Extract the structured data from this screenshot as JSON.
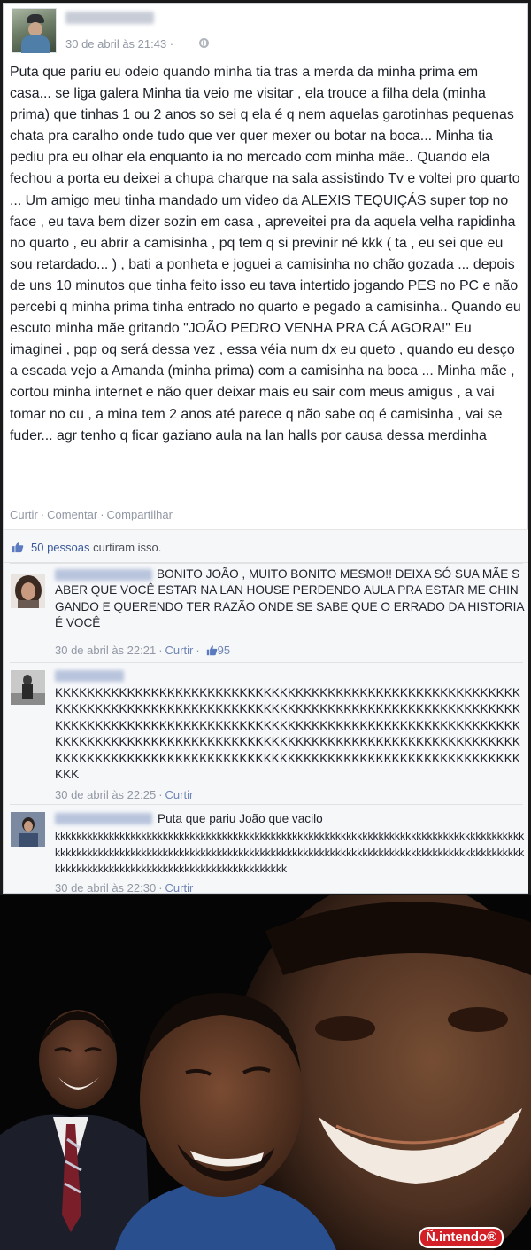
{
  "post": {
    "timestamp": "30 de abril às 21:43 ·",
    "privacy_icon": "globe-icon",
    "text": "Puta que pariu eu odeio quando minha tia tras a merda da minha prima em casa... se liga galera Minha tia veio me visitar , ela trouce a filha dela (minha prima) que tinhas 1 ou 2 anos so sei q ela é q nem aquelas garotinhas pequenas chata pra caralho onde tudo que ver quer mexer ou botar na boca... Minha tia pediu pra eu olhar ela enquanto ia no mercado com minha mãe.. Quando ela fechou a porta eu deixei a chupa charque na sala assistindo Tv e voltei pro quarto ... Um amigo meu tinha mandado um video da ALEXIS TEQUIÇÁS super top no face , eu tava bem dizer sozin em casa , apreveitei pra da aquela velha rapidinha no quarto , eu abrir a camisinha , pq tem q si previnir né kkk ( ta , eu sei que eu sou retardado... ) , bati a ponheta e joguei a camisinha no chão gozada ... depois de uns 10 minutos que tinha feito isso eu tava intertido jogando PES no PC e não percebi q minha prima tinha entrado no quarto e pegado a camisinha.. Quando eu escuto minha mãe gritando \"JOÃO PEDRO VENHA PRA CÁ AGORA!\" Eu imaginei , pqp oq será dessa vez , essa véia num dx eu queto , quando eu desço a escada vejo a Amanda (minha prima) com a camisinha na boca ... Minha mãe , cortou minha internet e não quer deixar mais eu sair com meus amigus , a vai tomar no cu , a mina tem 2 anos até parece q não sabe oq é camisinha , vai se fuder... agr tenho q ficar gaziano aula na lan halls por causa dessa merdinha",
    "actions": {
      "like": "Curtir",
      "comment": "Comentar",
      "share": "Compartilhar",
      "separator": "·"
    }
  },
  "likes": {
    "icon": "thumbs-up-icon",
    "count_text": "50 pessoas",
    "suffix": " curtiram isso."
  },
  "comments": [
    {
      "text": "BONITO JOÃO , MUITO BONITO MESMO!! DEIXA SÓ SUA MÃE SABER QUE VOCÊ ESTAR NA LAN HOUSE PERDENDO AULA PRA ESTAR ME CHINGANDO E QUERENDO TER RAZÃO ONDE SE SABE QUE O ERRADO DA HISTORIA É VOCÊ",
      "time": "30 de abril às 22:21",
      "like": "Curtir",
      "like_count": "95"
    },
    {
      "text": "KKKKKKKKKKKKKKKKKKKKKKKKKKKKKKKKKKKKKKKKKKKKKKKKKKKKKKKKKKKKKKKKKKKKKKKKKKKKKKKKKKKKKKKKKKKKKKKKKKKKKKKKKKKKKKKKKKKKKKKKKKKKKKKKKKKKKKKKKKKKKKKKKKKKKKKKKKKKKKKKKKKKKKKKKKKKKKKKKKKKKKKKKKKKKKKKKKKKKKKKKKKKKKKKKKKKKKKKKKKKKKKKKKKKKKKKKKKKKKKKKKKKKKKKKKKKKKKKKKKKKKKKKKKKKKKKKKKKKKKKKKKKKKKKKKKKK",
      "time": "30 de abril às 22:25",
      "like": "Curtir"
    },
    {
      "text_lead": "Puta que pariu João que vacilo",
      "text": "kkkkkkkkkkkkkkkkkkkkkkkkkkkkkkkkkkkkkkkkkkkkkkkkkkkkkkkkkkkkkkkkkkkkkkkkkkkkkkkkkkkkkkkkkkkkkkkkkkkkkkkkkkkkkkkkkkkkkkkkkkkkkkkkkkkkkkkkkkkkkkkkkkkkkkkkkkkkkkkkkkkkkkkkkkkkkkkkkkkkkkkkkkkkkkkkkkkkkkkkkkkkkkkkkkkkkkkkk",
      "time": "30 de abril às 22:30",
      "like": "Curtir"
    }
  ],
  "meme": {
    "logo_text": "Ñ.intendo®"
  },
  "colors": {
    "link": "#3b5998",
    "meta": "#9197a3",
    "logo_red": "#d31f26"
  }
}
